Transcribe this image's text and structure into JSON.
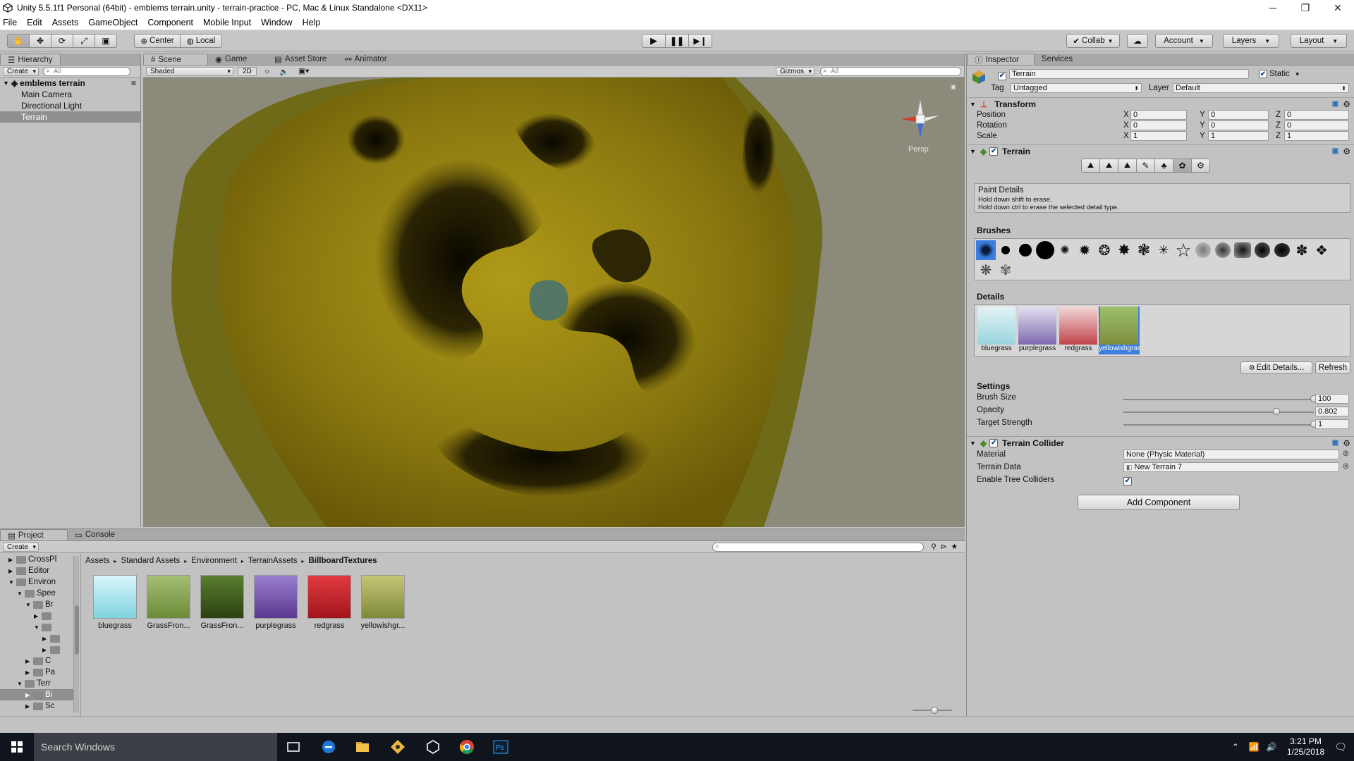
{
  "window": {
    "title": "Unity 5.5.1f1 Personal (64bit) - emblems terrain.unity - terrain-practice - PC, Mac & Linux Standalone <DX11>",
    "minimize": "─",
    "maximize": "❐",
    "close": "✕"
  },
  "menu": [
    "File",
    "Edit",
    "Assets",
    "GameObject",
    "Component",
    "Mobile Input",
    "Window",
    "Help"
  ],
  "toolbar": {
    "center_label": "Center",
    "local_label": "Local",
    "collab_label": "Collab",
    "account_label": "Account",
    "layers_label": "Layers",
    "layout_label": "Layout"
  },
  "hierarchy": {
    "tab": "Hierarchy",
    "create": "Create",
    "search_placeholder": "All",
    "scene_name": "emblems terrain",
    "items": [
      "Main Camera",
      "Directional Light",
      "Terrain"
    ]
  },
  "scene": {
    "tabs": [
      "Scene",
      "Game",
      "Asset Store",
      "Animator"
    ],
    "shading": "Shaded",
    "mode_2d": "2D",
    "gizmos": "Gizmos",
    "search_placeholder": "All",
    "persp_label": "Persp"
  },
  "inspector": {
    "tabs": [
      "Inspector",
      "Services"
    ],
    "object_name": "Terrain",
    "static_label": "Static",
    "tag_label": "Tag",
    "tag_value": "Untagged",
    "layer_label": "Layer",
    "layer_value": "Default",
    "transform": {
      "title": "Transform",
      "rows": [
        {
          "label": "Position",
          "x": "0",
          "y": "0",
          "z": "0"
        },
        {
          "label": "Rotation",
          "x": "0",
          "y": "0",
          "z": "0"
        },
        {
          "label": "Scale",
          "x": "1",
          "y": "1",
          "z": "1"
        }
      ]
    },
    "terrain": {
      "title": "Terrain",
      "mode_title": "Paint Details",
      "hint1": "Hold down shift to erase.",
      "hint2": "Hold down ctrl to erase the selected detail type.",
      "brushes_label": "Brushes",
      "details_label": "Details",
      "details": [
        {
          "name": "bluegrass",
          "color": "#9ad4dd"
        },
        {
          "name": "purplegrass",
          "color": "#7e6bb0"
        },
        {
          "name": "redgrass",
          "color": "#c0454a"
        },
        {
          "name": "yellowishgrass",
          "color": "#7f8e3e"
        }
      ],
      "edit_details": "Edit Details...",
      "refresh": "Refresh",
      "settings_label": "Settings",
      "settings": [
        {
          "label": "Brush Size",
          "value": "100",
          "fraction": 1.0
        },
        {
          "label": "Opacity",
          "value": "0.802",
          "fraction": 0.802
        },
        {
          "label": "Target Strength",
          "value": "1",
          "fraction": 1.0
        }
      ]
    },
    "collider": {
      "title": "Terrain Collider",
      "material_label": "Material",
      "material_value": "None (Physic Material)",
      "data_label": "Terrain Data",
      "data_value": "New Terrain 7",
      "trees_label": "Enable Tree Colliders"
    },
    "add_component": "Add Component"
  },
  "project": {
    "tabs": [
      "Project",
      "Console"
    ],
    "create": "Create",
    "tree": [
      {
        "label": "CrossPl",
        "indent": 1,
        "open": false
      },
      {
        "label": "Editor",
        "indent": 1,
        "open": false
      },
      {
        "label": "Environ",
        "indent": 1,
        "open": true
      },
      {
        "label": "Spee",
        "indent": 2,
        "open": true
      },
      {
        "label": "Br",
        "indent": 3,
        "open": true
      },
      {
        "label": "",
        "indent": 4,
        "open": false
      },
      {
        "label": "",
        "indent": 4,
        "open": true
      },
      {
        "label": "",
        "indent": 5,
        "open": false
      },
      {
        "label": "",
        "indent": 5,
        "open": false
      },
      {
        "label": "C",
        "indent": 3,
        "open": false
      },
      {
        "label": "Pa",
        "indent": 3,
        "open": false
      },
      {
        "label": "Terr",
        "indent": 2,
        "open": true
      },
      {
        "label": "Bi",
        "indent": 3,
        "open": false,
        "selected": true
      },
      {
        "label": "Sc",
        "indent": 3,
        "open": false
      }
    ],
    "breadcrumb": [
      "Assets",
      "Standard Assets",
      "Environment",
      "TerrainAssets",
      "BillboardTextures"
    ],
    "assets": [
      {
        "name": "bluegrass",
        "color": "#7fd3e0"
      },
      {
        "name": "GrassFron...",
        "color": "#6d8a3a"
      },
      {
        "name": "GrassFron...",
        "color": "#3c5a1c"
      },
      {
        "name": "purplegrass",
        "color": "#6a4aa0"
      },
      {
        "name": "redgrass",
        "color": "#c21f27"
      },
      {
        "name": "yellowishgr...",
        "color": "#8f9a45"
      }
    ]
  },
  "taskbar": {
    "search_placeholder": "Search Windows",
    "time": "3:21 PM",
    "date": "1/25/2018"
  }
}
